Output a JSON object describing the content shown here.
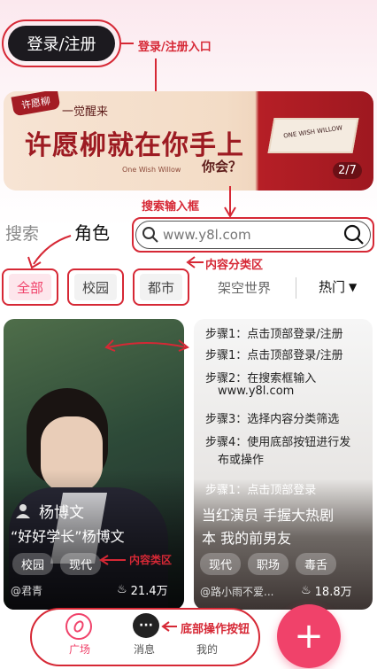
{
  "header": {
    "login_label": "登录/注册",
    "login_annotation": "登录/注册入口"
  },
  "banner": {
    "tag": "许愿柳",
    "subtitle": "一觉醒来",
    "title": "许愿柳就在你手上",
    "english": "One Wish Willow",
    "question": "你会？",
    "card_text": "ONE WISH WILLOW",
    "page_indicator": "2/7"
  },
  "search": {
    "annotation": "搜索输入框",
    "tab_search": "搜索",
    "tab_role": "角色",
    "placeholder": "www.y8l.com"
  },
  "categories": {
    "annotation": "内容分类区",
    "items": [
      "全部",
      "校园",
      "都市",
      "架空世界"
    ],
    "sort": "热门"
  },
  "cards": {
    "left": {
      "author_name": "杨博文",
      "title": "“好好学长”杨博文",
      "tags": [
        "校园",
        "现代"
      ],
      "tag_annotation": "内容类区",
      "user": "@君青",
      "likes": "21.4万"
    },
    "right": {
      "steps": [
        "步骤1：点击顶部登录/注册",
        "步骤1：点击顶部登录/注册",
        "步骤2：在搜索框输入",
        "www.y8l.com",
        "步骤3：选择内容分类筛选",
        "步骤4：使用底部按钮进行发",
        "布或操作",
        "步骤1：点击顶部登录"
      ],
      "title_line1": "当红演员 手握大热剧",
      "title_line2": "本 我的前男友",
      "tags": [
        "现代",
        "职场",
        "毒舌"
      ],
      "user": "@路小雨不爱...",
      "likes": "18.8万"
    }
  },
  "bottom_nav": {
    "items": [
      "广场",
      "消息",
      "我的"
    ],
    "annotation": "底部操作按钮",
    "fab": "+"
  },
  "colors": {
    "annotation_red": "#d62835",
    "fab_pink": "#f0426a"
  }
}
